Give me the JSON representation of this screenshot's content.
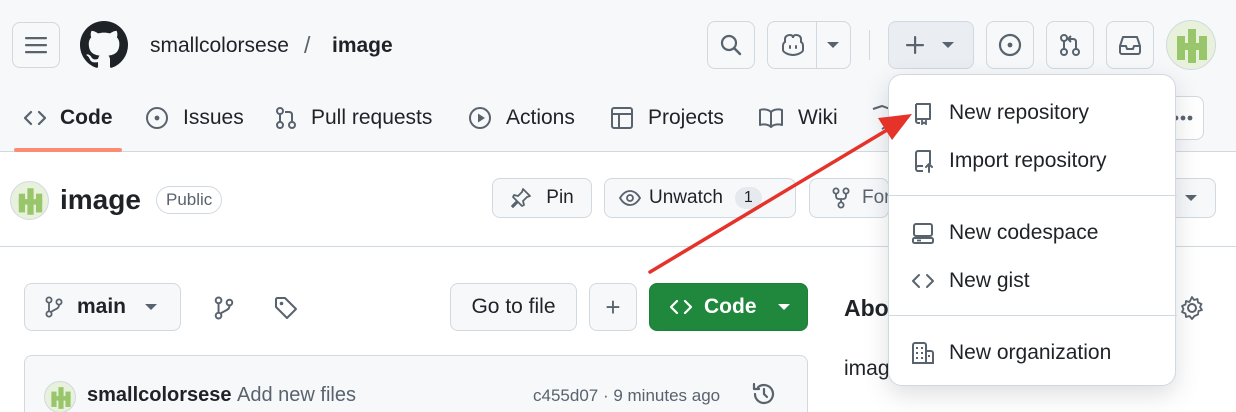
{
  "header": {
    "owner": "smallcolorsese",
    "separator": "/",
    "repo": "image"
  },
  "tabs": [
    {
      "label": "Code"
    },
    {
      "label": "Issues"
    },
    {
      "label": "Pull requests"
    },
    {
      "label": "Actions"
    },
    {
      "label": "Projects"
    },
    {
      "label": "Wiki"
    }
  ],
  "repo": {
    "name": "image",
    "visibility": "Public",
    "pin_label": "Pin",
    "unwatch_label": "Unwatch",
    "watch_count": "1",
    "fork_label_partial": "For"
  },
  "toolbar": {
    "branch": "main",
    "go_to_file": "Go to file",
    "add": "+",
    "code_label": "Code"
  },
  "commit": {
    "author": "smallcolorsese",
    "message": "Add new files",
    "meta": "c455d07 · 9 minutes ago"
  },
  "sidebar": {
    "about_partial": "Abo",
    "desc_partial": "imag"
  },
  "dropdown": {
    "items": [
      {
        "label": "New repository",
        "icon": "repo-icon"
      },
      {
        "label": "Import repository",
        "icon": "repo-push-icon"
      },
      {
        "label": "New codespace",
        "icon": "codespaces-icon"
      },
      {
        "label": "New gist",
        "icon": "code-icon"
      },
      {
        "label": "New organization",
        "icon": "organization-icon"
      }
    ]
  },
  "colors": {
    "accent_green": "#1f883d",
    "tab_underline": "#fd8c73",
    "annotation_arrow": "#e5332a"
  }
}
